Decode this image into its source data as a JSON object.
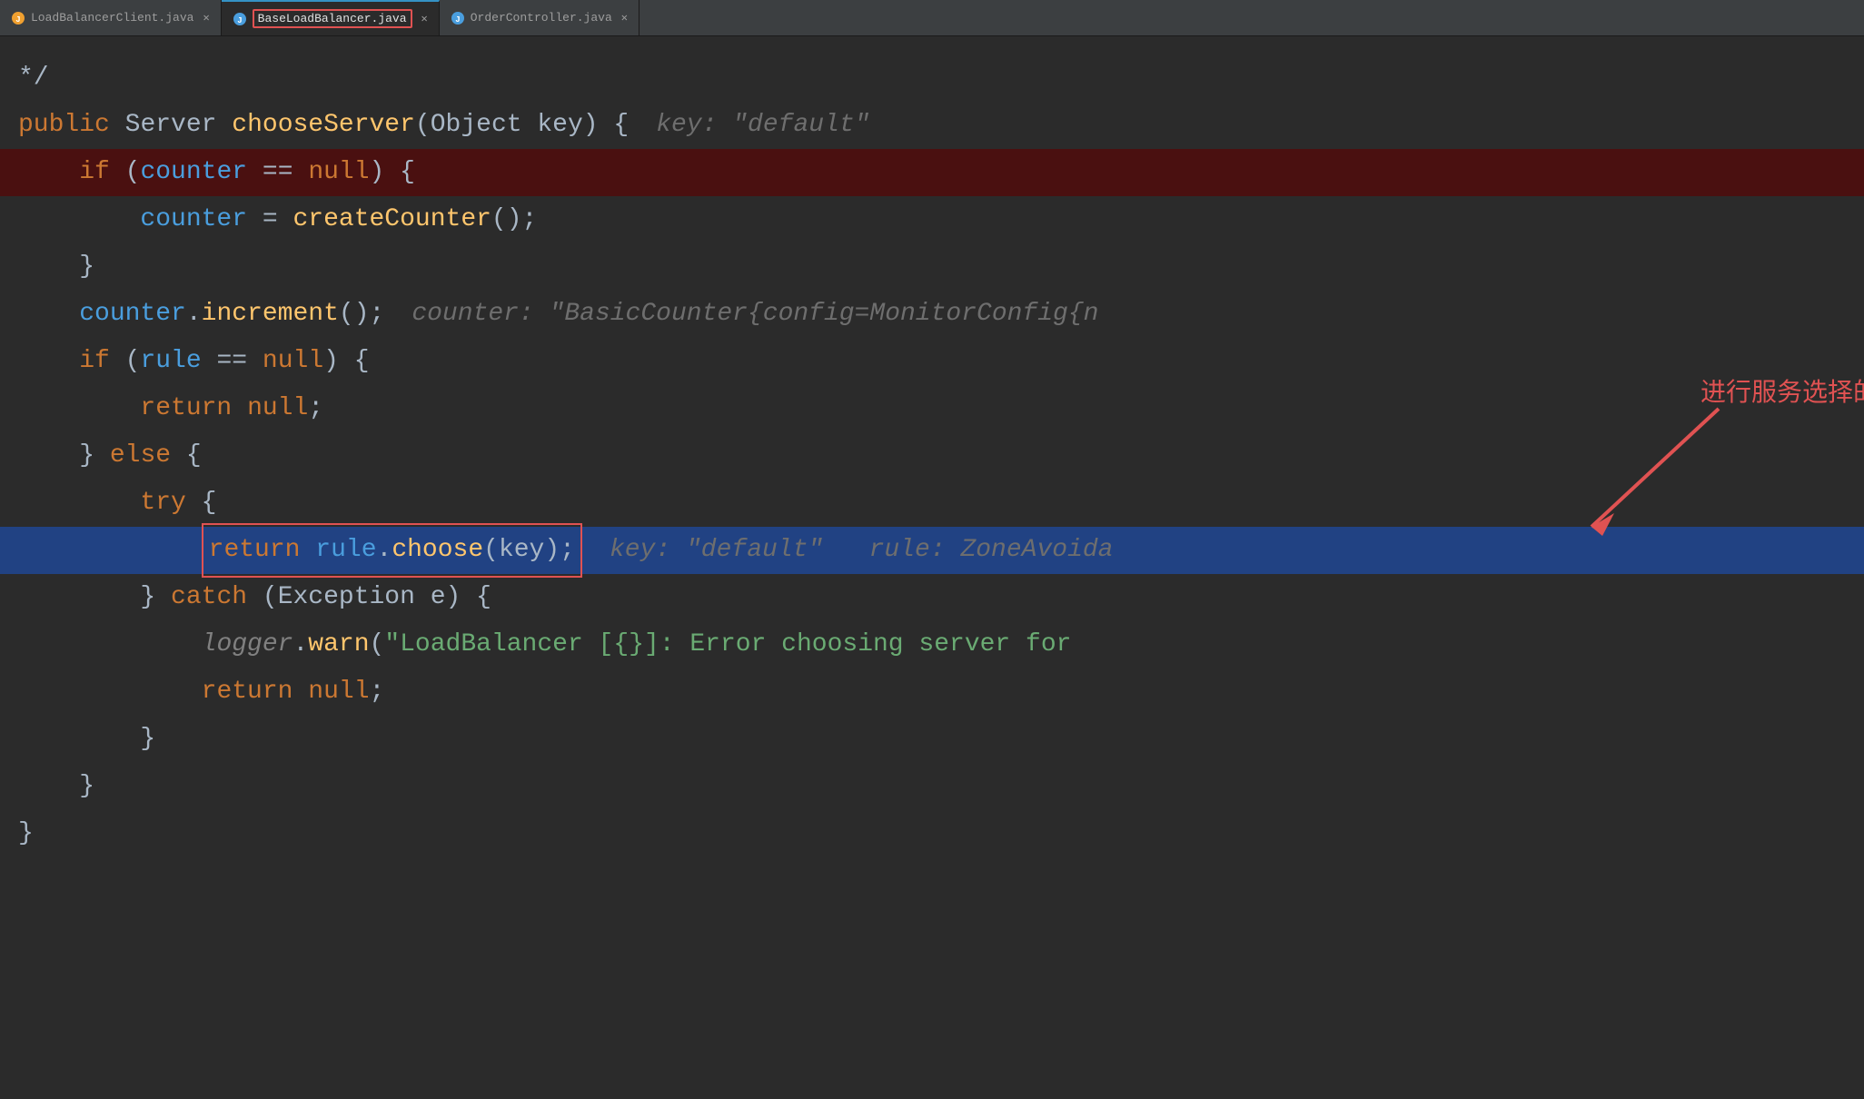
{
  "tabs": [
    {
      "id": "tab1",
      "label": "LoadBalancerClient.java",
      "icon_color": "#f0a030",
      "active": false
    },
    {
      "id": "tab2",
      "label": "BaseLoadBalancer.java",
      "icon_color": "#4a9ede",
      "active": true
    },
    {
      "id": "tab3",
      "label": "OrderController.java",
      "icon_color": "#4a9ede",
      "active": false
    }
  ],
  "code": {
    "lines": [
      {
        "id": "l0",
        "content": "*/",
        "highlight": false,
        "dark_highlight": false
      },
      {
        "id": "l1",
        "content": "public Server chooseServer(Object key) {",
        "hint": "key: \"default\"",
        "highlight": false,
        "dark_highlight": false
      },
      {
        "id": "l2",
        "content": "    if (counter == null) {",
        "highlight": false,
        "dark_highlight": true
      },
      {
        "id": "l3",
        "content": "        counter = createCounter();",
        "highlight": false,
        "dark_highlight": false
      },
      {
        "id": "l4",
        "content": "    }",
        "highlight": false,
        "dark_highlight": false
      },
      {
        "id": "l5",
        "content": "    counter.increment();",
        "hint": "counter: \"BasicCounter{config=MonitorConfig{n",
        "highlight": false,
        "dark_highlight": false
      },
      {
        "id": "l6",
        "content": "    if (rule == null) {",
        "highlight": false,
        "dark_highlight": false
      },
      {
        "id": "l7",
        "content": "        return null;",
        "highlight": false,
        "dark_highlight": false
      },
      {
        "id": "l8",
        "content": "    } else {",
        "highlight": false,
        "dark_highlight": false
      },
      {
        "id": "l9",
        "content": "        try {",
        "highlight": false,
        "dark_highlight": false
      },
      {
        "id": "l10",
        "content": "            return rule.choose(key);",
        "hint": "key: \"default\"   rule: ZoneAvoida",
        "highlight": true,
        "dark_highlight": false
      },
      {
        "id": "l11",
        "content": "        } catch (Exception e) {",
        "highlight": false,
        "dark_highlight": false
      },
      {
        "id": "l12",
        "content": "            logger.warn(\"LoadBalancer [{}]:  Error choosing server for",
        "highlight": false,
        "dark_highlight": false
      },
      {
        "id": "l13",
        "content": "            return null;",
        "highlight": false,
        "dark_highlight": false
      },
      {
        "id": "l14",
        "content": "        }",
        "highlight": false,
        "dark_highlight": false
      },
      {
        "id": "l15",
        "content": "    }",
        "highlight": false,
        "dark_highlight": false
      },
      {
        "id": "l16",
        "content": "}",
        "highlight": false,
        "dark_highlight": false
      }
    ]
  },
  "annotation": {
    "text": "进行服务选择的是这个",
    "highlight_word": "rule"
  }
}
